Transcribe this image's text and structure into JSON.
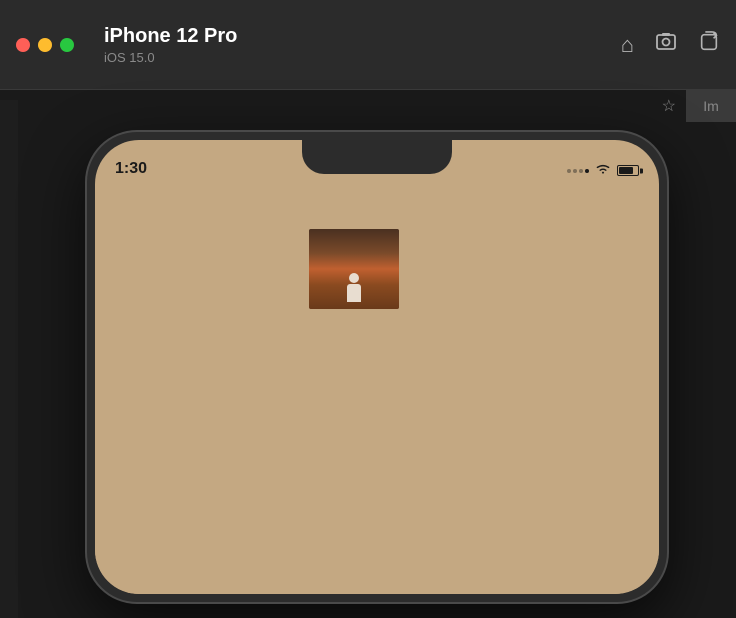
{
  "titlebar": {
    "device_name": "iPhone 12 Pro",
    "device_os": "iOS 15.0",
    "traffic_lights": {
      "red_label": "close",
      "yellow_label": "minimize",
      "green_label": "maximize"
    },
    "icons": {
      "home": "⌂",
      "screenshot": "📷",
      "rotate": "↩"
    }
  },
  "top_strip": {
    "star_icon": "★",
    "person_icon": "Im"
  },
  "status_bar": {
    "time": "1:30",
    "battery_level": "70"
  },
  "colors": {
    "titlebar_bg": "#2b2b2b",
    "content_bg": "#1a1a1a",
    "phone_bg": "#2c2c2c",
    "screen_bg": "#c4a882"
  }
}
